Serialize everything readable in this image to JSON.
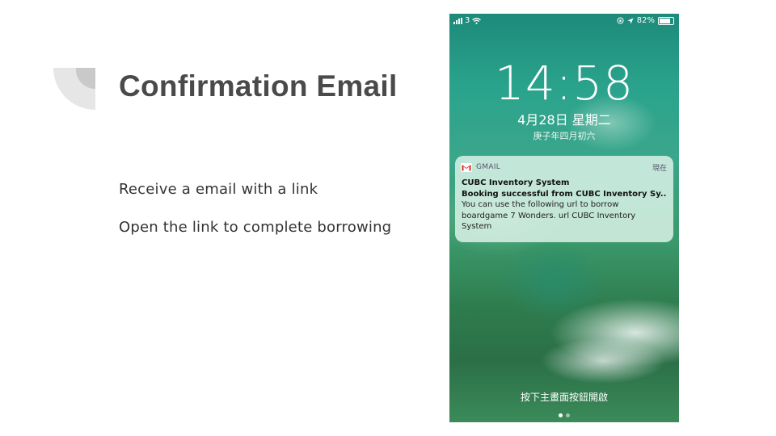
{
  "slide": {
    "title": "Confirmation Email",
    "bullets": [
      "Receive a email with a link",
      "Open the link to complete borrowing"
    ]
  },
  "phone": {
    "status_bar": {
      "carrier": "3",
      "battery": "82%"
    },
    "lock_screen": {
      "time": "14:58",
      "date": "4月28日 星期二",
      "lunar_date": "庚子年四月初六",
      "unlock_hint": "按下主畫面按鈕開啟"
    },
    "notification": {
      "app": "GMAIL",
      "when": "現在",
      "title": "CUBC Inventory System",
      "subtitle": "Booking successful from CUBC Inventory Sy...",
      "message": "You can use the following url to borrow boardgame 7 Wonders. url CUBC Inventory System",
      "icon": "gmail-icon"
    }
  },
  "colors": {
    "title": "#4a4a4a",
    "decoration": "#d6d6d6"
  }
}
